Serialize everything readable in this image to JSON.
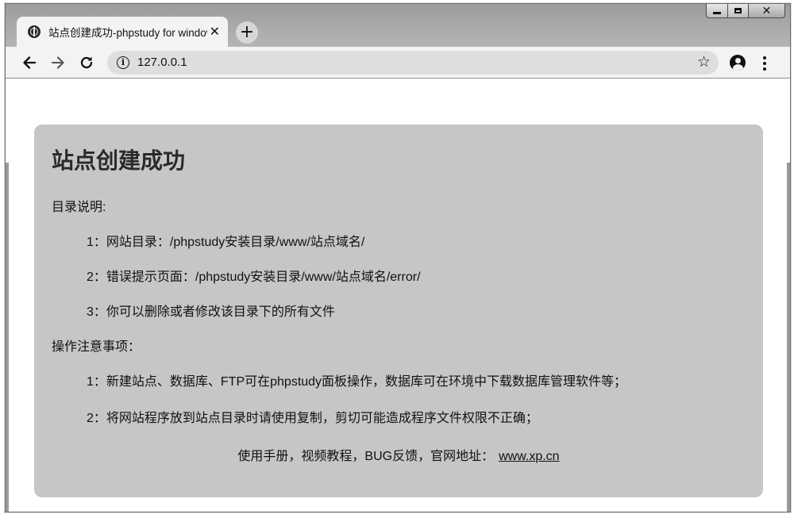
{
  "browser": {
    "tab": {
      "title": "站点创建成功-phpstudy for windows",
      "close_glyph": "✕",
      "favicon": "globe-icon"
    },
    "new_tab_glyph": "+",
    "window_controls": {
      "close_glyph": "✕"
    },
    "url": "127.0.0.1",
    "icons": {
      "back": "arrow-left-icon",
      "forward": "arrow-right-icon",
      "reload": "reload-icon",
      "site_info": "info-icon",
      "bookmark": "star-icon",
      "account": "account-icon",
      "menu": "more-vert-icon"
    }
  },
  "page": {
    "title": "站点创建成功",
    "dir_heading": "目录说明:",
    "dir_items": [
      "1：网站目录：/phpstudy安装目录/www/站点域名/",
      "2：错误提示页面：/phpstudy安装目录/www/站点域名/error/",
      "3：你可以删除或者修改该目录下的所有文件"
    ],
    "notes_heading": "操作注意事项：",
    "notes_items": [
      "1：新建站点、数据库、FTP可在phpstudy面板操作，数据库可在环境中下载数据库管理软件等；",
      "2：将网站程序放到站点目录时请使用复制，剪切可能造成程序文件权限不正确；"
    ],
    "footer_text": "使用手册，视频教程，BUG反馈，官网地址：",
    "footer_link": "www.xp.cn"
  },
  "colors": {
    "card_background": "#c6c6c6",
    "tabstrip": "#a8a8a8",
    "toolbar": "#f3f3f3"
  }
}
